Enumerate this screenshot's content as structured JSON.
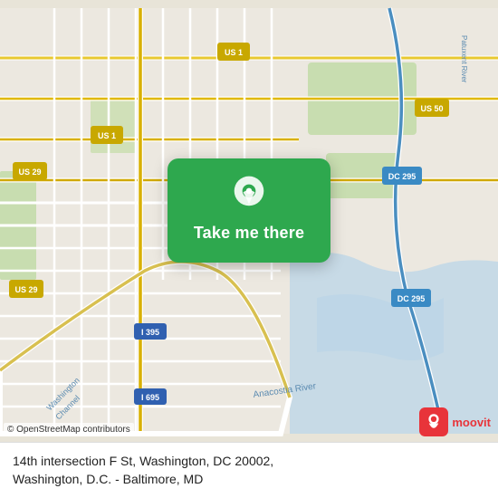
{
  "map": {
    "alt": "Map of Washington DC showing 14th intersection F St",
    "osm_attribution": "© OpenStreetMap contributors",
    "center_lat": 38.896,
    "center_lon": -77.031
  },
  "overlay": {
    "button_label": "Take me there",
    "pin_alt": "Location pin"
  },
  "bottom_bar": {
    "address_line1": "14th intersection F St, Washington, DC 20002,",
    "address_line2": "Washington, D.C. - Baltimore, MD"
  },
  "branding": {
    "moovit_label": "moovit"
  },
  "route_badges": [
    {
      "label": "US 1",
      "color": "#c8a800"
    },
    {
      "label": "US 29",
      "color": "#c8a800"
    },
    {
      "label": "US 50",
      "color": "#c8a800"
    },
    {
      "label": "DC 295",
      "color": "#4a90c8"
    },
    {
      "label": "I 395",
      "color": "#4a7ec8"
    },
    {
      "label": "I 695",
      "color": "#4a7ec8"
    }
  ]
}
